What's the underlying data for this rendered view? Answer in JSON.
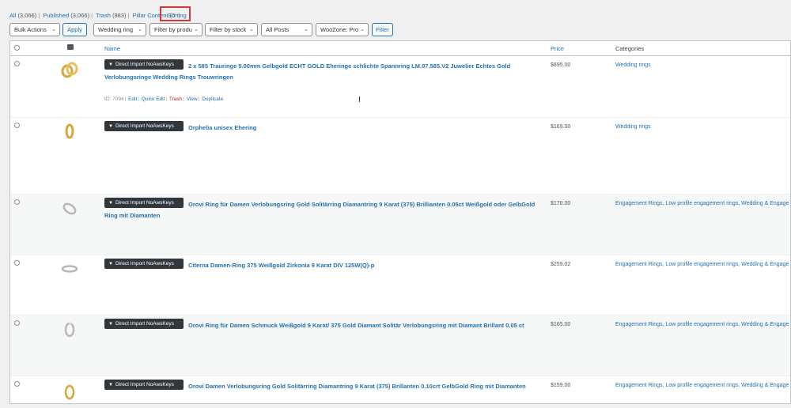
{
  "status_links": [
    {
      "label": "All",
      "count": "(3,066)"
    },
    {
      "label": "Published",
      "count": "(3,066)"
    },
    {
      "label": "Trash",
      "count": "(983)"
    },
    {
      "label": "Pillar Content",
      "count": "(0"
    }
  ],
  "sorting_label": "Sorting",
  "highlight_color": "#d63638",
  "tablenav": {
    "bulk_actions": "Bulk Actions",
    "apply": "Apply",
    "category_filter": "Wedding ring",
    "product_type_filter": "Filter by produ",
    "stock_filter": "Filter by stock",
    "posts_filter": "All Posts",
    "woozone_filter": "WooZone: Pro",
    "filter": "Filter"
  },
  "columns": {
    "image_icon": "image-icon",
    "name": "Name",
    "price": "Price",
    "categories": "Categories"
  },
  "import_button_label": "Direct Import NoAwsKeys",
  "rows": [
    {
      "title": "2 x 585 Trauringe 5.00mm Gelbgold ECHT GOLD Eheringe schlichte Spannring LM.07.585.V2 Juwelier Echtes Gold Verlobungsringe Wedding Rings Trouwringen",
      "price": "$695.00",
      "categories": "Wedding rings",
      "actions": {
        "id": "ID: 7094",
        "edit": "Edit",
        "quick_edit": "Quick Edit",
        "trash": "Trash",
        "view": "View",
        "duplicate": "Duplicate"
      }
    },
    {
      "title": "Orphelia unisex Ehering",
      "price": "$169.00",
      "categories": "Wedding rings"
    },
    {
      "title": "Orovi Ring für Damen Verlobungsring Gold Solitärring Diamantring 9 Karat (375) Brillianten 0.05ct Weißgold oder GelbGold Ring mit Diamanten",
      "price": "$170.00",
      "categories": "Engagement Rings, Low profile engagement rings, Wedding & Engage"
    },
    {
      "title": "Citerna Damen-Ring 375 Weißgold Zirkonia 9 Karat DIV 125W(Q)-p",
      "price": "$259.02",
      "categories": "Engagement Rings, Low profile engagement rings, Wedding & Engage"
    },
    {
      "title": "Orovi Ring für Damen Schmuck Weißgold 9 Karat/ 375 Gold Diamant Solitär Verlobungsring mit Diamant Brillant 0.05 ct",
      "price": "$165.00",
      "categories": "Engagement Rings, Low profile engagement rings, Wedding & Engage"
    },
    {
      "title": "Orovi Damen Verlobungsring Gold Solitärring Diamantring 9 Karat (375) Brillanten 0.10crt GelbGold Ring mit Diamanten",
      "price": "$159.00",
      "categories": "Engagement Rings, Low profile engagement rings, Wedding & Engage"
    }
  ]
}
